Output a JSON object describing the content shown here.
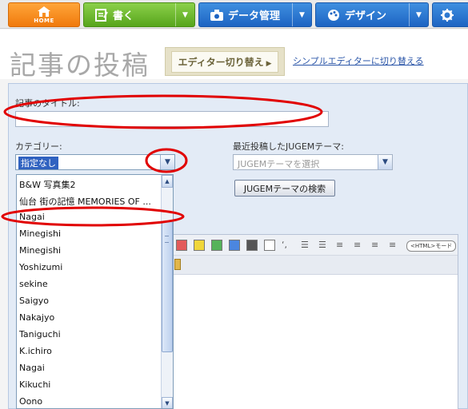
{
  "nav": {
    "home_label": "HOME",
    "write_label": "書く",
    "data_label": "データ管理",
    "design_label": "デザイン",
    "split_arrow": "▼"
  },
  "header": {
    "page_title": "記事の投稿",
    "switch_editor_label": "エディター切り替え",
    "switch_arrow": "▶",
    "simple_editor_link": "シンプルエディターに切り替える"
  },
  "form": {
    "title_label": "記事のタイトル:",
    "title_value": "",
    "category_label": "カテゴリー:",
    "category_selected": "指定なし",
    "jugem_label": "最近投稿したJUGEMテーマ:",
    "jugem_placeholder": "JUGEMテーマを選択",
    "jugem_search_button": "JUGEMテーマの検索",
    "select_arrow": "▼"
  },
  "editor": {
    "html_mode_label": "<HTML>モード",
    "swatch_colors": [
      "#e35a5a",
      "#f0d63a",
      "#55b35a",
      "#4b86e0",
      "#555555",
      "#ffffff"
    ]
  },
  "category_dropdown": {
    "items": [
      "B&W 写真集2",
      "仙台 街の記憶 MEMORIES OF ...",
      "Nagai",
      "Minegishi",
      "Minegishi",
      "Yoshizumi",
      "sekine",
      "Saigyo",
      "Nakajyo",
      "Taniguchi",
      "K.ichiro",
      "Nagai",
      "Kikuchi",
      "Oono"
    ],
    "scroll_up": "▲",
    "scroll_down": "▼"
  },
  "annotation": {
    "color": "#e10000"
  }
}
